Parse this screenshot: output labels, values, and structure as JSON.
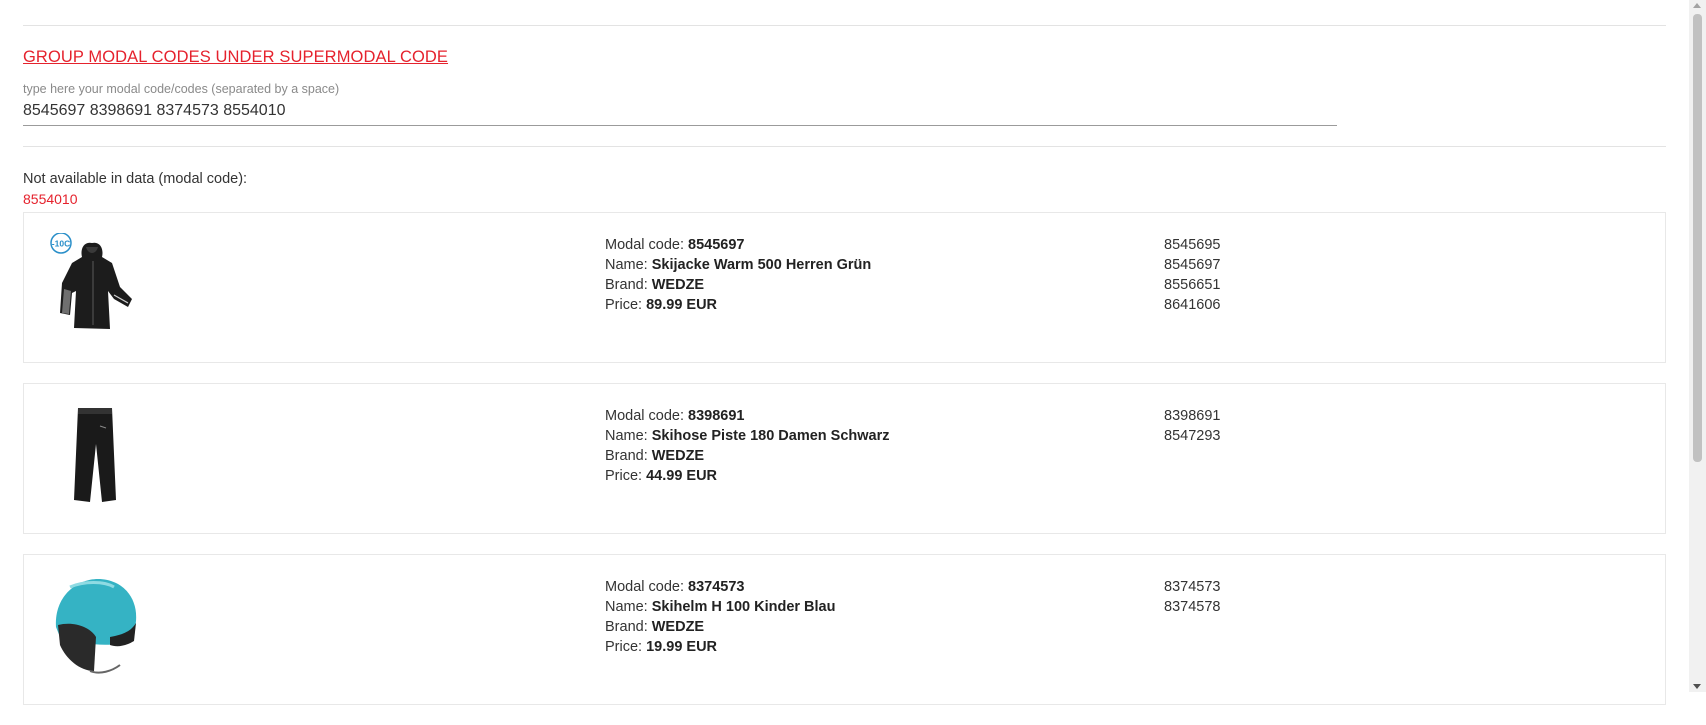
{
  "page": {
    "title": "GROUP MODAL CODES UNDER SUPERMODAL CODE",
    "input_label": "type here your modal code/codes (separated by a space)",
    "input_value": "8545697 8398691 8374573 8554010",
    "not_available_label": "Not available in data (modal code):",
    "not_available_code": "8554010"
  },
  "labels": {
    "modal_code": "Modal code: ",
    "name": "Name: ",
    "brand": "Brand: ",
    "price": "Price: "
  },
  "products": [
    {
      "image_icon": "ski-jacket-icon",
      "badge": "-10C",
      "modal_code": "8545697",
      "name": "Skijacke Warm 500 Herren Grün",
      "brand": "WEDZE",
      "price": "89.99 EUR",
      "codes": [
        "8545695",
        "8545697",
        "8556651",
        "8641606"
      ]
    },
    {
      "image_icon": "ski-pants-icon",
      "modal_code": "8398691",
      "name": "Skihose Piste 180 Damen Schwarz",
      "brand": "WEDZE",
      "price": "44.99 EUR",
      "codes": [
        "8398691",
        "8547293"
      ]
    },
    {
      "image_icon": "ski-helmet-icon",
      "modal_code": "8374573",
      "name": "Skihelm H 100 Kinder Blau",
      "brand": "WEDZE",
      "price": "19.99 EUR",
      "codes": [
        "8374573",
        "8374578"
      ]
    }
  ],
  "colors": {
    "accent": "#e5222d",
    "helmet": "#35b3c4"
  }
}
